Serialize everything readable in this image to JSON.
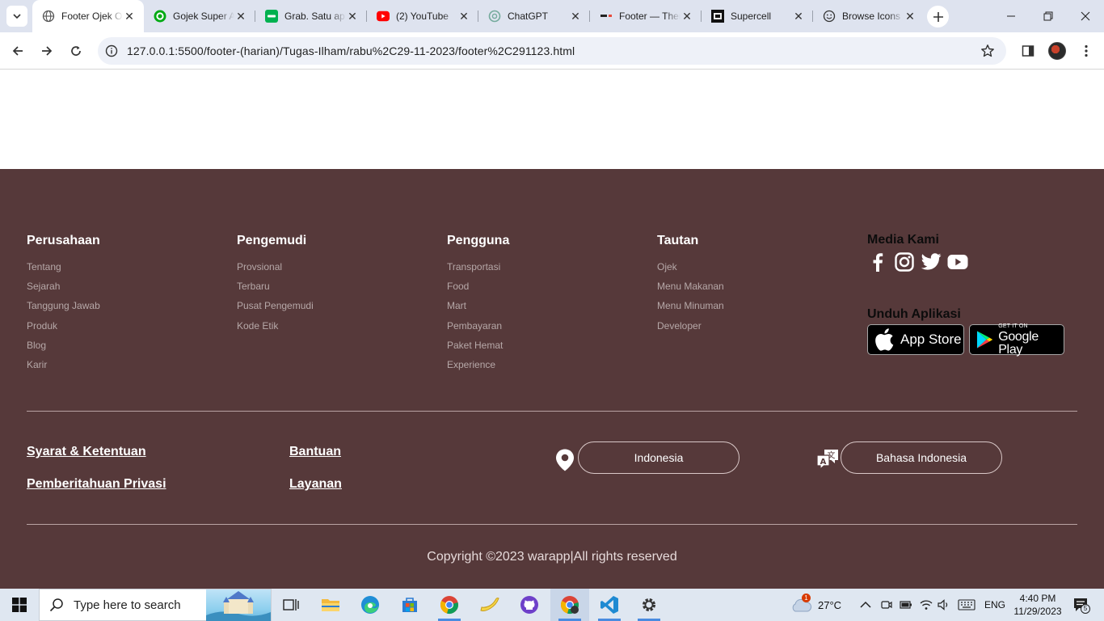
{
  "browser": {
    "tabs": [
      {
        "title": "Footer Ojek Online",
        "favicon": "globe-icon",
        "active": true
      },
      {
        "title": "Gojek Super App",
        "favicon": "gojek-icon",
        "active": false
      },
      {
        "title": "Grab. Satu aplikasi",
        "favicon": "grab-icon",
        "active": false
      },
      {
        "title": "(2) YouTube",
        "favicon": "youtube-icon",
        "active": false
      },
      {
        "title": "ChatGPT",
        "favicon": "chatgpt-icon",
        "active": false
      },
      {
        "title": "Footer — Themes",
        "favicon": "footer-icon",
        "active": false
      },
      {
        "title": "Supercell",
        "favicon": "supercell-icon",
        "active": false
      },
      {
        "title": "Browse Icons",
        "favicon": "smiley-icon",
        "active": false
      }
    ],
    "url": "127.0.0.1:5500/footer-(harian)/Tugas-Ilham/rabu%2C29-11-2023/footer%2C291123.html"
  },
  "footer": {
    "columns": [
      {
        "heading": "Perusahaan",
        "items": [
          "Tentang",
          "Sejarah",
          "Tanggung Jawab",
          "Produk",
          "Blog",
          "Karir"
        ]
      },
      {
        "heading": "Pengemudi",
        "items": [
          "Provsional",
          "Terbaru",
          "Pusat Pengemudi",
          "Kode Etik"
        ]
      },
      {
        "heading": "Pengguna",
        "items": [
          "Transportasi",
          "Food",
          "Mart",
          "Pembayaran",
          "Paket Hemat",
          "Experience"
        ]
      },
      {
        "heading": "Tautan",
        "items": [
          "Ojek",
          "Menu Makanan",
          "Menu Minuman",
          "Developer"
        ]
      }
    ],
    "media_heading": "Media Kami",
    "download_heading": "Unduh Aplikasi",
    "app_store_label": "App Store",
    "google_play_small": "GET IT ON",
    "google_play_label": "Google Play",
    "bottom_links": [
      "Syarat & Ketentuan",
      "Pemberitahuan Privasi",
      "Bantuan",
      "Layanan"
    ],
    "country_button": "Indonesia",
    "language_button": "Bahasa Indonesia",
    "copyright": "Copyright ©2023 warapp|All rights reserved"
  },
  "taskbar": {
    "search_placeholder": "Type here to search",
    "weather_temp": "27°C",
    "weather_badge": "1",
    "language": "ENG",
    "time": "4:40 PM",
    "date": "11/29/2023",
    "notification_count": "5"
  },
  "colors": {
    "footer_bg": "#56393a",
    "link_muted": "#b6a8a8",
    "tabstrip_bg": "#dee3ef"
  }
}
